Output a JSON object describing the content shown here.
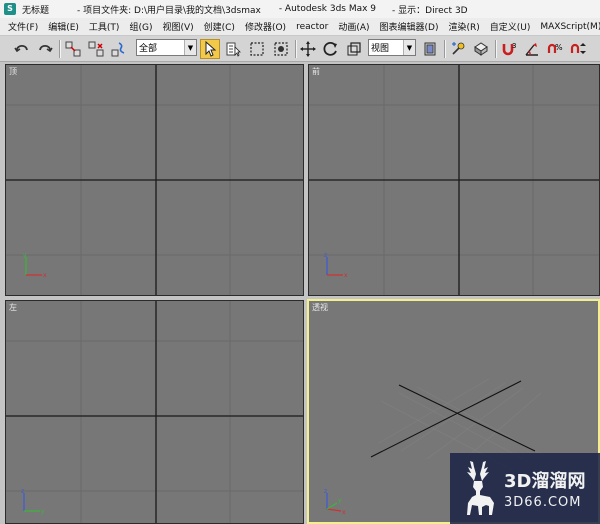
{
  "titlebar": {
    "doc_title": "无标题",
    "project_folder": "- 项目文件夹: D:\\用户目录\\我的文档\\3dsmax",
    "app_name": "- Autodesk 3ds Max 9",
    "display_driver": "- 显示：Direct 3D"
  },
  "menubar": {
    "items": [
      "文件(F)",
      "编辑(E)",
      "工具(T)",
      "组(G)",
      "视图(V)",
      "创建(C)",
      "修改器(O)",
      "reactor",
      "动画(A)",
      "图表编辑器(D)",
      "渲染(R)",
      "自定义(U)",
      "MAXScript(M)",
      "帮"
    ]
  },
  "toolbar": {
    "selection_filter": "全部",
    "reference_coord": "视图"
  },
  "viewports": {
    "top": {
      "label": "顶"
    },
    "front": {
      "label": "前"
    },
    "left": {
      "label": "左"
    },
    "perspective": {
      "label": "透视"
    }
  },
  "watermark": {
    "brand": "3D溜溜网",
    "url": "3D66.COM"
  },
  "colors": {
    "viewport_bg": "#777777",
    "active_border": "#f2ef8c",
    "axis_x": "#d23030",
    "axis_y": "#38b838",
    "axis_z": "#3a5ad8",
    "watermark_bg": "#1c2648"
  }
}
